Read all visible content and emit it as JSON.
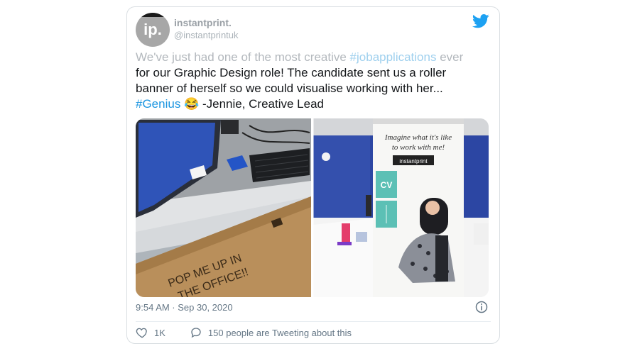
{
  "author": {
    "avatar_text": "ip.",
    "name": "instantprint.",
    "handle": "@instantprintuk"
  },
  "tweet": {
    "line1_prefix": "We've just had one of the most creative ",
    "line1_hashtag": "#jobapplications",
    "line1_suffix": " ever",
    "line2": "for our Graphic Design role! The candidate sent us a roller",
    "line3": "banner of herself so we could visualise working with her...",
    "line4_hashtag": "#Genius",
    "line4_emoji": "😂",
    "line4_suffix": " -Jennie, Creative Lead"
  },
  "photos": {
    "left": {
      "box_text_1": "POP ME UP IN",
      "box_text_2": "THE OFFICE!!"
    },
    "right": {
      "banner_line1": "Imagine what it's like",
      "banner_line2": "to work with me!",
      "banner_brand": "instantprint",
      "cv_label": "CV"
    }
  },
  "meta": {
    "timestamp": "9:54 AM · Sep 30, 2020"
  },
  "actions": {
    "likes": "1K",
    "tweeting": "150 people are Tweeting about this"
  },
  "colors": {
    "twitter_blue": "#1da1f2",
    "hashtag": "#1b95e0",
    "wall_blue": "#2c46a3"
  }
}
